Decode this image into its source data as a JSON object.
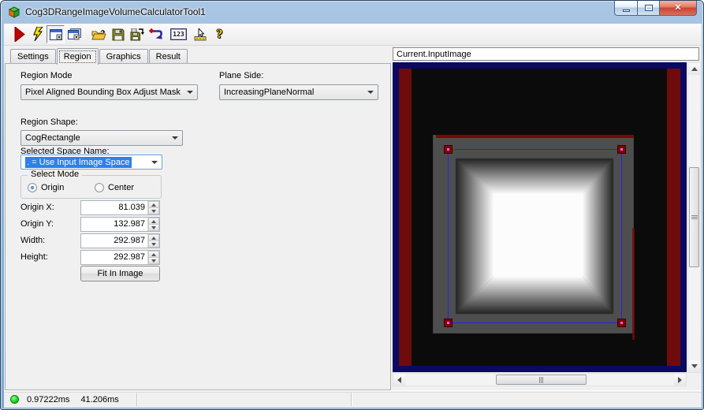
{
  "window": {
    "title": "Cog3DRangeImageVolumeCalculatorTool1"
  },
  "toolbar": {
    "icons": [
      {
        "name": "run"
      },
      {
        "name": "electric-run"
      },
      {
        "name": "show-image-pane",
        "pressed": true
      },
      {
        "name": "float-image-pane"
      },
      {
        "name": "open-file"
      },
      {
        "name": "save-file"
      },
      {
        "name": "save-image"
      },
      {
        "name": "reset"
      },
      {
        "name": "numeric-precision",
        "glyph": "123"
      },
      {
        "name": "position-tool"
      },
      {
        "name": "help",
        "glyph": "?"
      }
    ]
  },
  "tabs": [
    {
      "label": "Settings",
      "active": false
    },
    {
      "label": "Region",
      "active": true
    },
    {
      "label": "Graphics",
      "active": false
    },
    {
      "label": "Result",
      "active": false
    }
  ],
  "form": {
    "region_mode_label": "Region Mode",
    "region_mode_value": "Pixel Aligned Bounding Box Adjust Mask",
    "plane_side_label": "Plane Side:",
    "plane_side_value": "IncreasingPlaneNormal",
    "region_shape_label": "Region Shape:",
    "region_shape_value": "CogRectangle",
    "selected_space_label": "Selected Space Name:",
    "selected_space_value": ". = Use Input Image Space",
    "select_mode_label": "Select Mode",
    "radio_origin_label": "Origin",
    "radio_center_label": "Center",
    "fields": [
      {
        "label": "Origin X:",
        "value": "81.039"
      },
      {
        "label": "Origin Y:",
        "value": "132.987"
      },
      {
        "label": "Width:",
        "value": "292.987"
      },
      {
        "label": "Height:",
        "value": "292.987"
      }
    ],
    "fit_button_label": "Fit In Image"
  },
  "display": {
    "source_selector_value": "Current.InputImage"
  },
  "status": {
    "run_time": "0.97222ms",
    "total_time": "41.206ms"
  },
  "colors": {
    "selection_blue": "#2f80e8",
    "overlay_rect_blue": "#2222ee",
    "handle_red": "#7c0606",
    "handle_dot_magenta": "#ff55ff",
    "image_border_navy": "#0a0a62",
    "image_band_red": "#6e0b0b",
    "status_indicator_green": "#21d421"
  }
}
